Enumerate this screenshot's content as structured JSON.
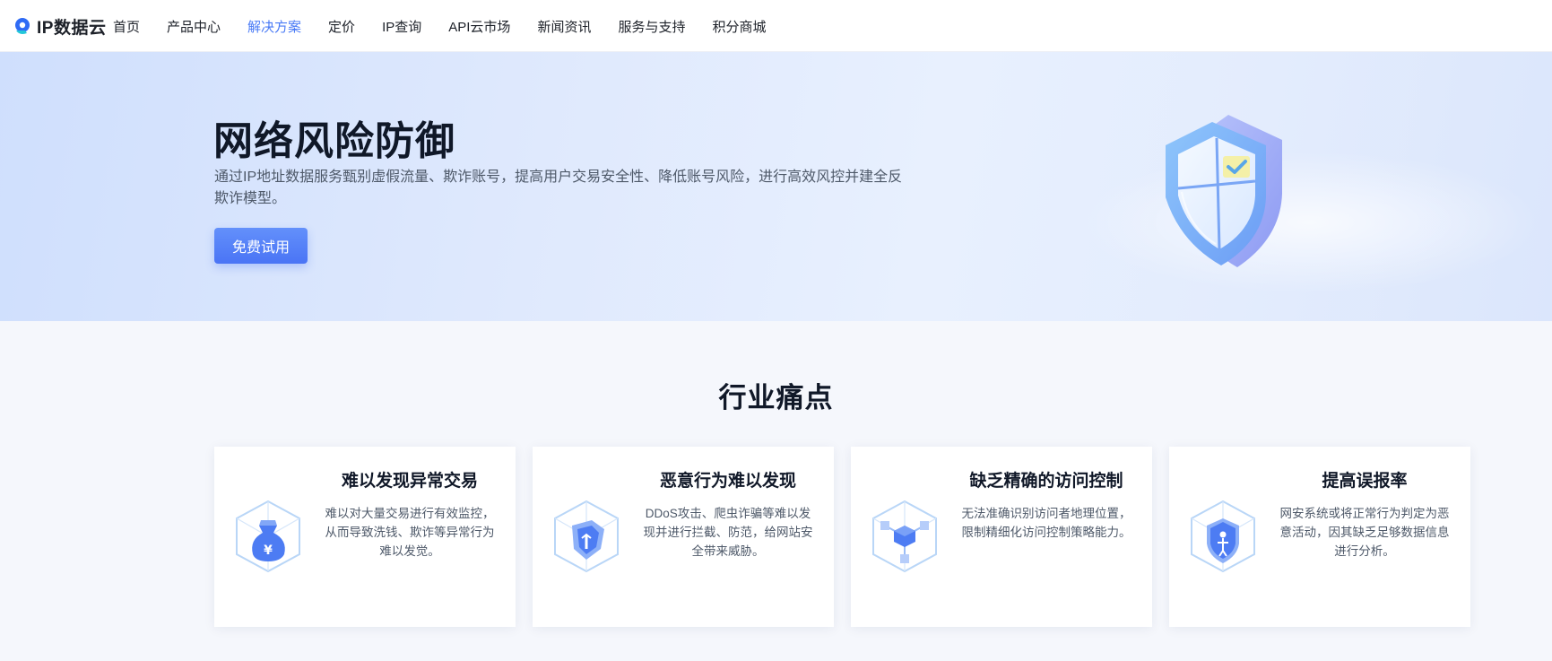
{
  "brand": {
    "name": "IP数据云",
    "logo_icon": "ip-cloud-logo-icon"
  },
  "nav": {
    "items": [
      "首页",
      "产品中心",
      "解决方案",
      "定价",
      "IP查询",
      "API云市场",
      "新闻资讯",
      "服务与支持",
      "积分商城"
    ],
    "active": "解决方案"
  },
  "hero": {
    "title": "网络风险防御",
    "description": "通过IP地址数据服务甄别虚假流量、欺诈账号，提高用户交易安全性、降低账号风险，进行高效风控并建全反欺诈模型。",
    "cta_label": "免费试用",
    "illustration_icon": "shield-check-icon"
  },
  "pain_points": {
    "title": "行业痛点",
    "cards": [
      {
        "title": "难以发现异常交易",
        "description": "难以对大量交易进行有效监控，从而导致洗钱、欺诈等异常行为难以发觉。",
        "icon": "money-bag-cube-icon"
      },
      {
        "title": "恶意行为难以发现",
        "description": "DDoS攻击、爬虫诈骗等难以发现并进行拦截、防范，给网站安全带来威胁。",
        "icon": "shield-cube-icon"
      },
      {
        "title": "缺乏精确的访问控制",
        "description": "无法准确识别访问者地理位置，限制精细化访问控制策略能力。",
        "icon": "network-cube-icon"
      },
      {
        "title": "提高误报率",
        "description": "网安系统或将正常行为判定为恶意活动，因其缺乏足够数据信息进行分析。",
        "icon": "shield-person-cube-icon"
      }
    ]
  },
  "colors": {
    "accent": "#4a7bf6",
    "primary_button": "#5580f8",
    "hero_bg": "#dde8fd"
  }
}
